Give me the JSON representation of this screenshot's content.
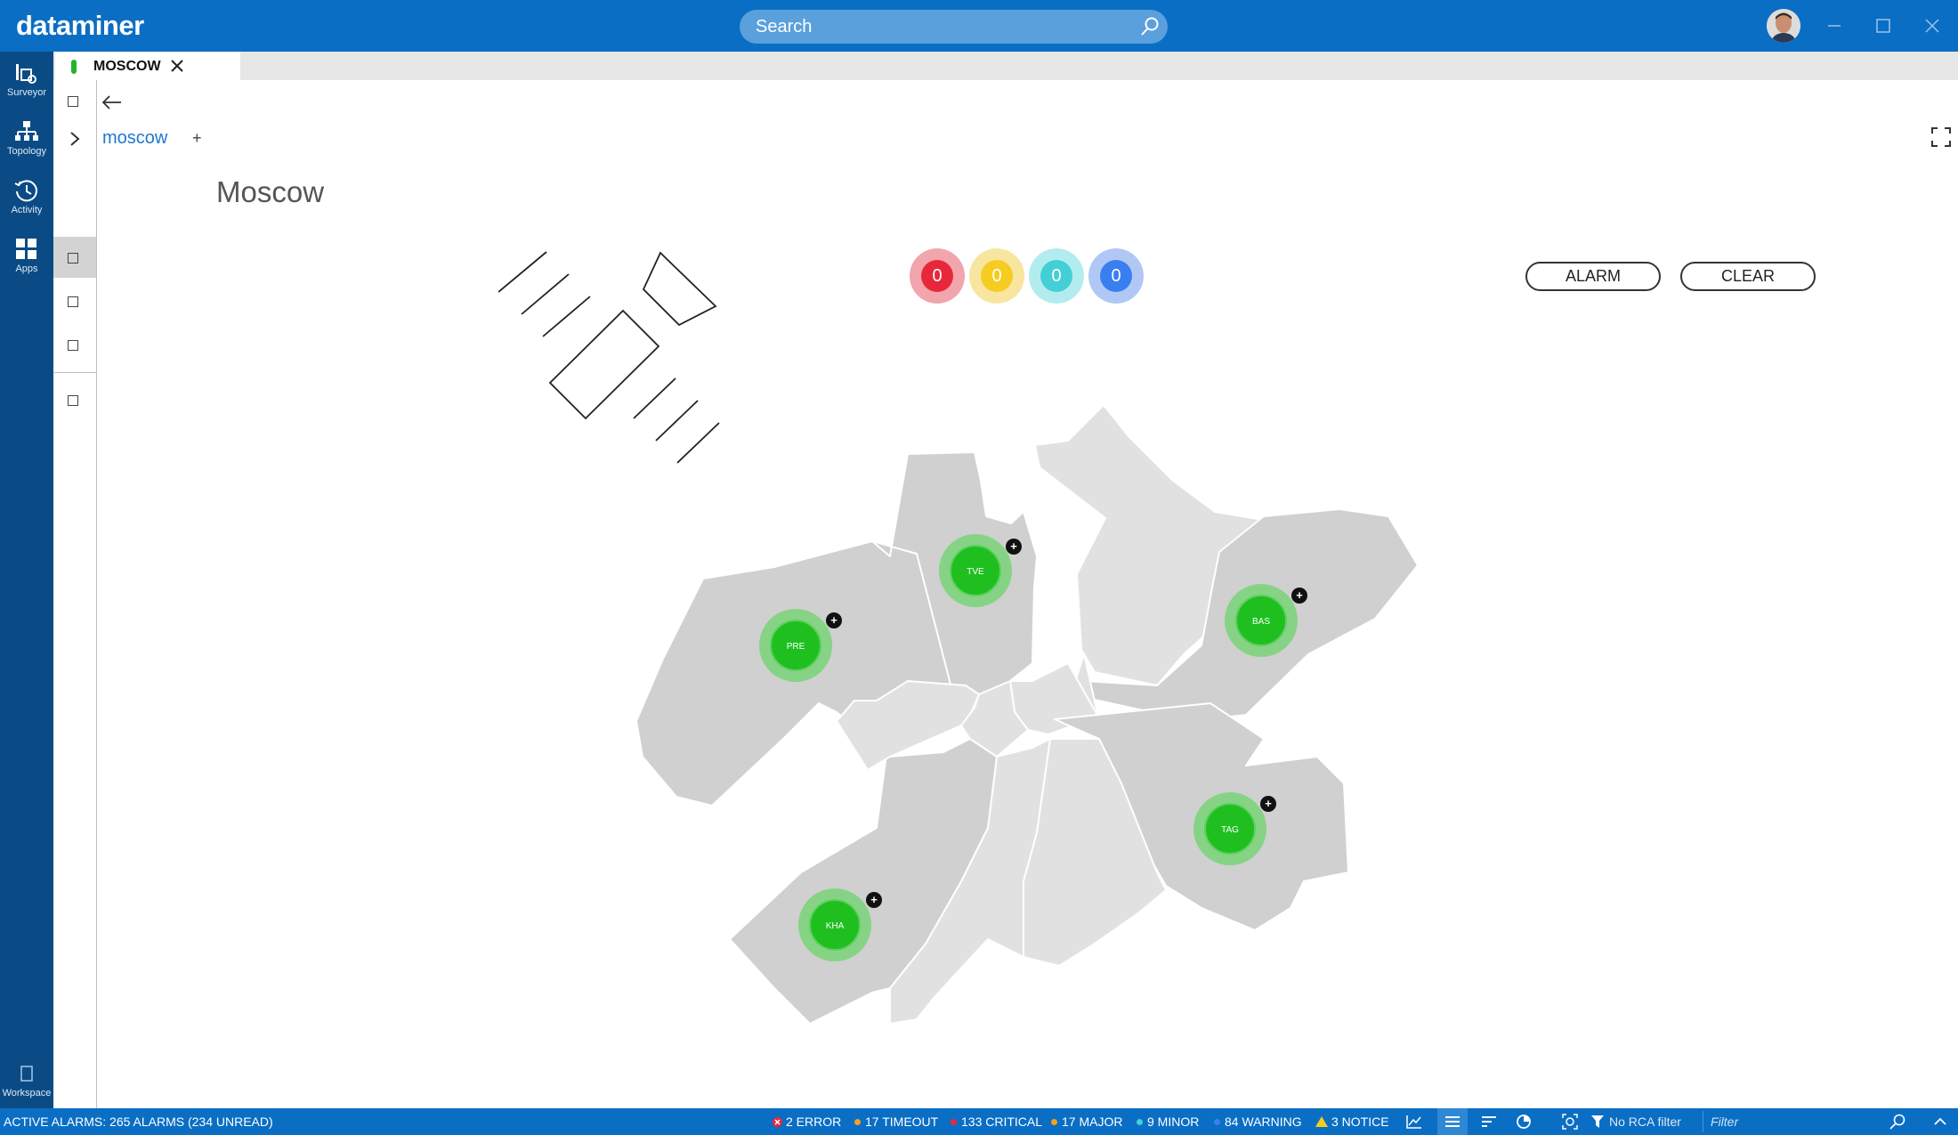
{
  "app": {
    "logo": "dataminer"
  },
  "search": {
    "placeholder": "Search"
  },
  "sidebar": {
    "items": [
      {
        "label": "Surveyor",
        "icon": "surveyor-icon"
      },
      {
        "label": "Topology",
        "icon": "topology-icon"
      },
      {
        "label": "Activity",
        "icon": "activity-icon"
      },
      {
        "label": "Apps",
        "icon": "apps-icon"
      }
    ],
    "workspace": {
      "label": "Workspace",
      "icon": "workspace-icon"
    }
  },
  "tab": {
    "label": "MOSCOW",
    "status_color": "#21b42f"
  },
  "breadcrumb": {
    "label": "moscow",
    "add": "+"
  },
  "page": {
    "title": "Moscow"
  },
  "alarm_summary": [
    {
      "value": "0",
      "color": "#e8283a",
      "ring": "#f2a5ad"
    },
    {
      "value": "0",
      "color": "#f5cc1f",
      "ring": "#f8e6a0"
    },
    {
      "value": "0",
      "color": "#43cfd6",
      "ring": "#b3ecef"
    },
    {
      "value": "0",
      "color": "#3a7ff0",
      "ring": "#b1c8f5"
    }
  ],
  "buttons": {
    "alarm": "ALARM",
    "clear": "CLEAR"
  },
  "map": {
    "districts": [
      {
        "code": "PRE",
        "status": "#1fbf1f"
      },
      {
        "code": "TVE",
        "status": "#1fbf1f"
      },
      {
        "code": "BAS",
        "status": "#1fbf1f"
      },
      {
        "code": "TAG",
        "status": "#1fbf1f"
      },
      {
        "code": "KHA",
        "status": "#1fbf1f"
      }
    ]
  },
  "statusbar": {
    "active_alarms": "ACTIVE ALARMS: 265 ALARMS (234 UNREAD)",
    "counts": [
      {
        "label": "2 ERROR",
        "color": "#e8283a"
      },
      {
        "label": "17 TIMEOUT",
        "color": "#f3a21b"
      },
      {
        "label": "133 CRITICAL",
        "color": "#e8283a"
      },
      {
        "label": "17 MAJOR",
        "color": "#f3a21b"
      },
      {
        "label": "9 MINOR",
        "color": "#43cfd6"
      },
      {
        "label": "84 WARNING",
        "color": "#3a7ff0"
      },
      {
        "label": "3 NOTICE",
        "color": "#f5cc1f"
      }
    ],
    "rca": "No RCA filter",
    "filter_placeholder": "Filter"
  }
}
